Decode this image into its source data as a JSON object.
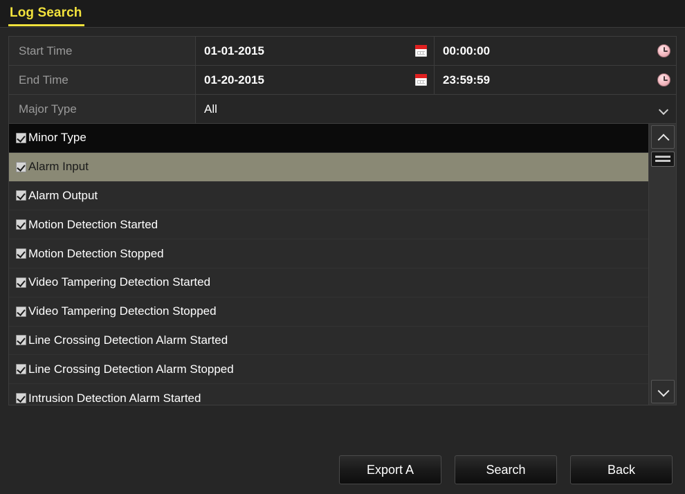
{
  "window": {
    "tab_label": "Log Search"
  },
  "form": {
    "rows": [
      {
        "label": "Start Time",
        "date": "01-01-2015",
        "time": "00:00:00",
        "date_icon": "calendar-icon",
        "time_icon": "clock-icon"
      },
      {
        "label": "End Time",
        "date": "01-20-2015",
        "time": "23:59:59",
        "date_icon": "calendar-icon",
        "time_icon": "clock-icon"
      }
    ],
    "major_type": {
      "label": "Major Type",
      "value": "All",
      "icon": "chevron-down-icon"
    }
  },
  "minor_type_list": {
    "header": {
      "label": "Minor Type",
      "checked": true
    },
    "items": [
      {
        "label": "Alarm Input",
        "checked": true,
        "selected": true
      },
      {
        "label": "Alarm Output",
        "checked": true,
        "selected": false
      },
      {
        "label": "Motion Detection Started",
        "checked": true,
        "selected": false
      },
      {
        "label": "Motion Detection Stopped",
        "checked": true,
        "selected": false
      },
      {
        "label": "Video Tampering Detection Started",
        "checked": true,
        "selected": false
      },
      {
        "label": "Video Tampering Detection Stopped",
        "checked": true,
        "selected": false
      },
      {
        "label": "Line Crossing Detection Alarm Started",
        "checked": true,
        "selected": false
      },
      {
        "label": "Line Crossing Detection Alarm Stopped",
        "checked": true,
        "selected": false
      },
      {
        "label": "Intrusion Detection Alarm Started",
        "checked": true,
        "selected": false
      }
    ],
    "scrollbar": {
      "up_icon": "chevron-up-icon",
      "down_icon": "chevron-down-icon",
      "thumb": "scrollbar-thumb"
    }
  },
  "footer": {
    "export_label": "Export A",
    "search_label": "Search",
    "back_label": "Back"
  },
  "colors": {
    "accent": "#f2e23c",
    "background": "#262626",
    "row_background": "#2b2b2b",
    "header_background": "#0b0b0b",
    "selection": "#8a8975",
    "label_text": "#9a9a9a",
    "value_text": "#ffffff",
    "border": "#3d3d3d"
  }
}
